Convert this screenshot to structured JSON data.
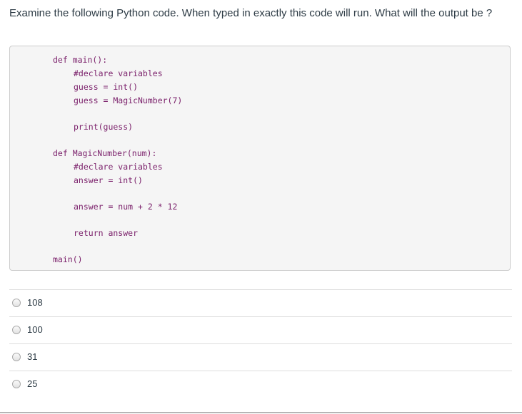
{
  "question": {
    "text": "Examine the following Python code.  When typed in exactly this code will run.  What will the output be ?"
  },
  "code": {
    "lines": [
      "def main():",
      "#declare variables",
      "guess = int()",
      "guess = MagicNumber(7)",
      "print(guess)",
      "def MagicNumber(num):",
      "#declare variables",
      "answer = int()",
      "answer = num + 2 * 12",
      "return answer",
      "main()"
    ]
  },
  "answers": [
    {
      "label": "108"
    },
    {
      "label": "100"
    },
    {
      "label": "31"
    },
    {
      "label": "25"
    }
  ],
  "colors": {
    "code_text": "#7a1f6a",
    "code_background": "#f5f5f5",
    "body_text": "#2d3b45"
  }
}
